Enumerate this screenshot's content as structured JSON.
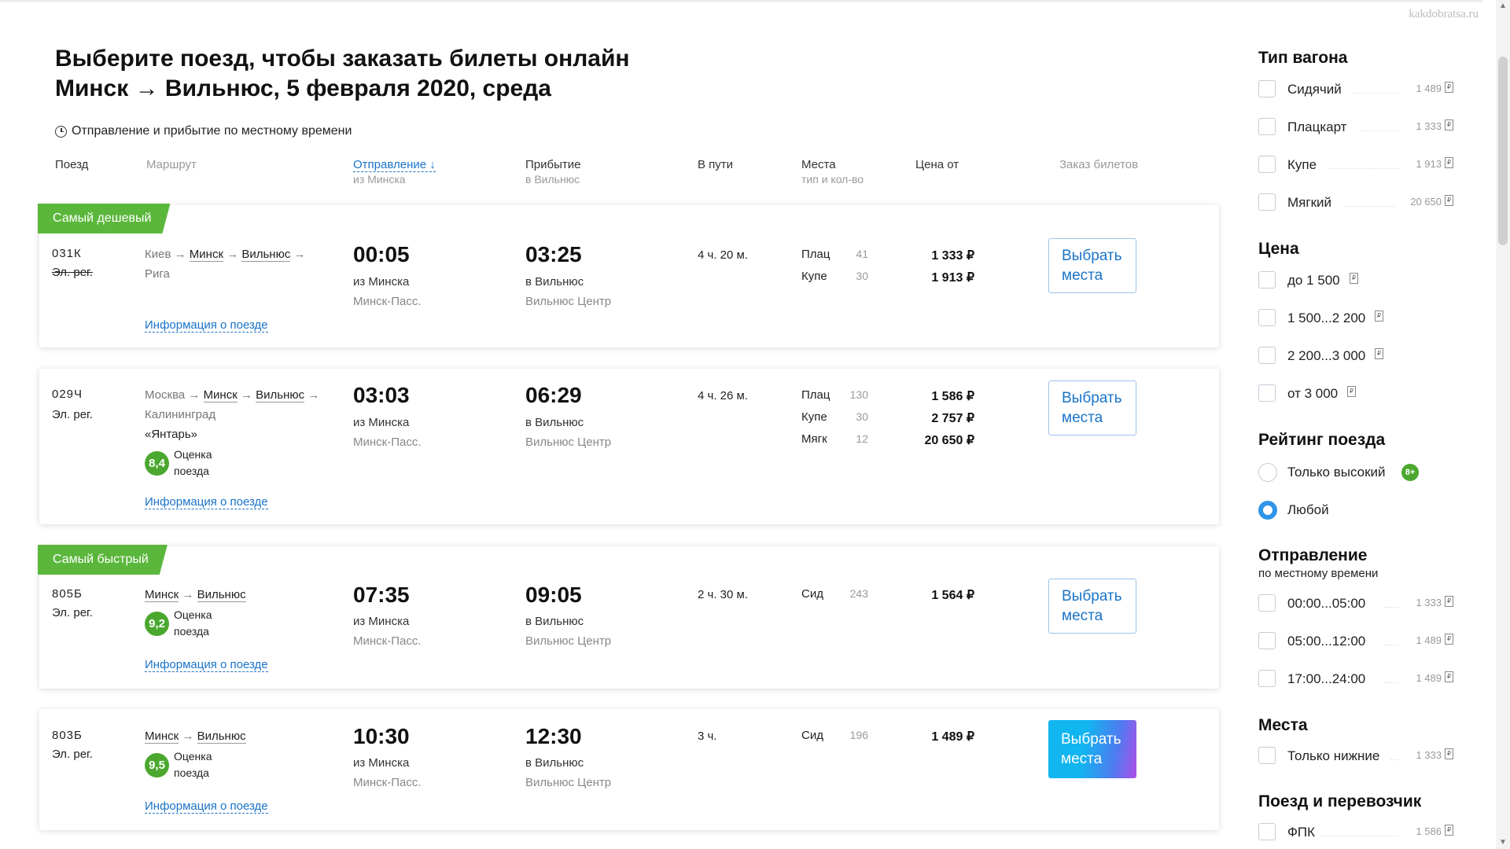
{
  "watermark": "kakdobratsa.ru",
  "page": {
    "title_line1": "Выберите поезд, чтобы заказать билеты онлайн",
    "title_line2": "Минск → Вильнюс, 5 февраля 2020, среда",
    "local_time_note": "Отправление и прибытие по местному времени"
  },
  "columns": {
    "train": "Поезд",
    "route": "Маршрут",
    "departure": "Отправление ↓",
    "departure_sub": "из Минска",
    "arrival": "Прибытие",
    "arrival_sub": "в Вильнюс",
    "duration": "В пути",
    "seats": "Места",
    "seats_sub": "тип и кол-во",
    "price": "Цена от",
    "order": "Заказ билетов"
  },
  "trains": [
    {
      "badge": "Самый дешевый",
      "number": "031К",
      "class": "Эл. рег.",
      "route_pre": "Киев →",
      "route_from": "Минск",
      "route_to": "Вильнюс",
      "route_post": "→ Рига",
      "departure_time": "00:05",
      "departure_from": "из Минска",
      "departure_station": "Минск-Пасс.",
      "arrival_time": "03:25",
      "arrival_to": "в Вильнюс",
      "arrival_station": "Вильнюс Центр",
      "duration": "4 ч. 20 м.",
      "seats": [
        {
          "type": "Плац",
          "count": "41",
          "price": "1 333 ₽"
        },
        {
          "type": "Купе",
          "count": "30",
          "price": "1 913 ₽"
        }
      ],
      "info_link": "Информация о поезде",
      "button": "Выбрать места"
    },
    {
      "number": "029Ч",
      "class": "Эл. рег.",
      "route_pre": "Москва →",
      "route_from": "Минск",
      "route_to": "Вильнюс",
      "route_post": "→ Калининград",
      "train_name": "«Янтарь»",
      "rating": "8,4",
      "rating_label": "Оценка поезда",
      "departure_time": "03:03",
      "departure_from": "из Минска",
      "departure_station": "Минск-Пасс.",
      "arrival_time": "06:29",
      "arrival_to": "в Вильнюс",
      "arrival_station": "Вильнюс Центр",
      "duration": "4 ч. 26 м.",
      "seats": [
        {
          "type": "Плац",
          "count": "130",
          "price": "1 586 ₽"
        },
        {
          "type": "Купе",
          "count": "30",
          "price": "2 757 ₽"
        },
        {
          "type": "Мягк",
          "count": "12",
          "price": "20 650 ₽"
        }
      ],
      "info_link": "Информация о поезде",
      "button": "Выбрать места"
    },
    {
      "badge": "Самый быстрый",
      "number": "805Б",
      "class": "Эл. рег.",
      "route_from": "Минск",
      "route_to": "Вильнюс",
      "rating": "9,2",
      "rating_label": "Оценка поезда",
      "departure_time": "07:35",
      "departure_from": "из Минска",
      "departure_station": "Минск-Пасс.",
      "arrival_time": "09:05",
      "arrival_to": "в Вильнюс",
      "arrival_station": "Вильнюс Центр",
      "duration": "2 ч. 30 м.",
      "seats": [
        {
          "type": "Сид",
          "count": "243",
          "price": "1 564 ₽"
        }
      ],
      "info_link": "Информация о поезде",
      "button": "Выбрать места"
    },
    {
      "number": "803Б",
      "class": "Эл. рег.",
      "route_from": "Минск",
      "route_to": "Вильнюс",
      "rating": "9,5",
      "rating_label": "Оценка поезда",
      "departure_time": "10:30",
      "departure_from": "из Минска",
      "departure_station": "Минск-Пасс.",
      "arrival_time": "12:30",
      "arrival_to": "в Вильнюс",
      "arrival_station": "Вильнюс Центр",
      "duration": "3 ч.",
      "seats": [
        {
          "type": "Сид",
          "count": "196",
          "price": "1 489 ₽"
        }
      ],
      "info_link": "Информация о поезде",
      "button": "Выбрать места"
    }
  ],
  "filters": {
    "wagon_type": {
      "title": "Тип вагона",
      "options": [
        {
          "label": "Сидячий",
          "count": "1 489"
        },
        {
          "label": "Плацкарт",
          "count": "1 333"
        },
        {
          "label": "Купе",
          "count": "1 913"
        },
        {
          "label": "Мягкий",
          "count": "20 650"
        }
      ]
    },
    "price": {
      "title": "Цена",
      "options": [
        {
          "label": "до 1 500"
        },
        {
          "label": "1 500...2 200"
        },
        {
          "label": "2 200...3 000"
        },
        {
          "label": "от 3 000"
        }
      ]
    },
    "rating": {
      "title": "Рейтинг поезда",
      "options": [
        {
          "label": "Только высокий",
          "badge": "8+",
          "selected": false
        },
        {
          "label": "Любой",
          "selected": true
        }
      ]
    },
    "departure": {
      "title": "Отправление",
      "subtitle": "по местному времени",
      "options": [
        {
          "label": "00:00...05:00",
          "count": "1 333"
        },
        {
          "label": "05:00...12:00",
          "count": "1 489"
        },
        {
          "label": "17:00...24:00",
          "count": "1 489"
        }
      ]
    },
    "places": {
      "title": "Места",
      "options": [
        {
          "label": "Только нижние",
          "count": "1 333"
        }
      ]
    },
    "carrier": {
      "title": "Поезд и перевозчик",
      "options": [
        {
          "label": "ФПК",
          "count": "1 586"
        }
      ]
    }
  },
  "colors": {
    "accent_blue": "#1a73c8",
    "badge_green": "#5bb73c",
    "rating_green": "#4aa82e",
    "radio_blue": "#2f95e8"
  },
  "icons": [
    "clock-icon",
    "ruble-icon",
    "scroll-up-icon",
    "scroll-down-icon"
  ]
}
